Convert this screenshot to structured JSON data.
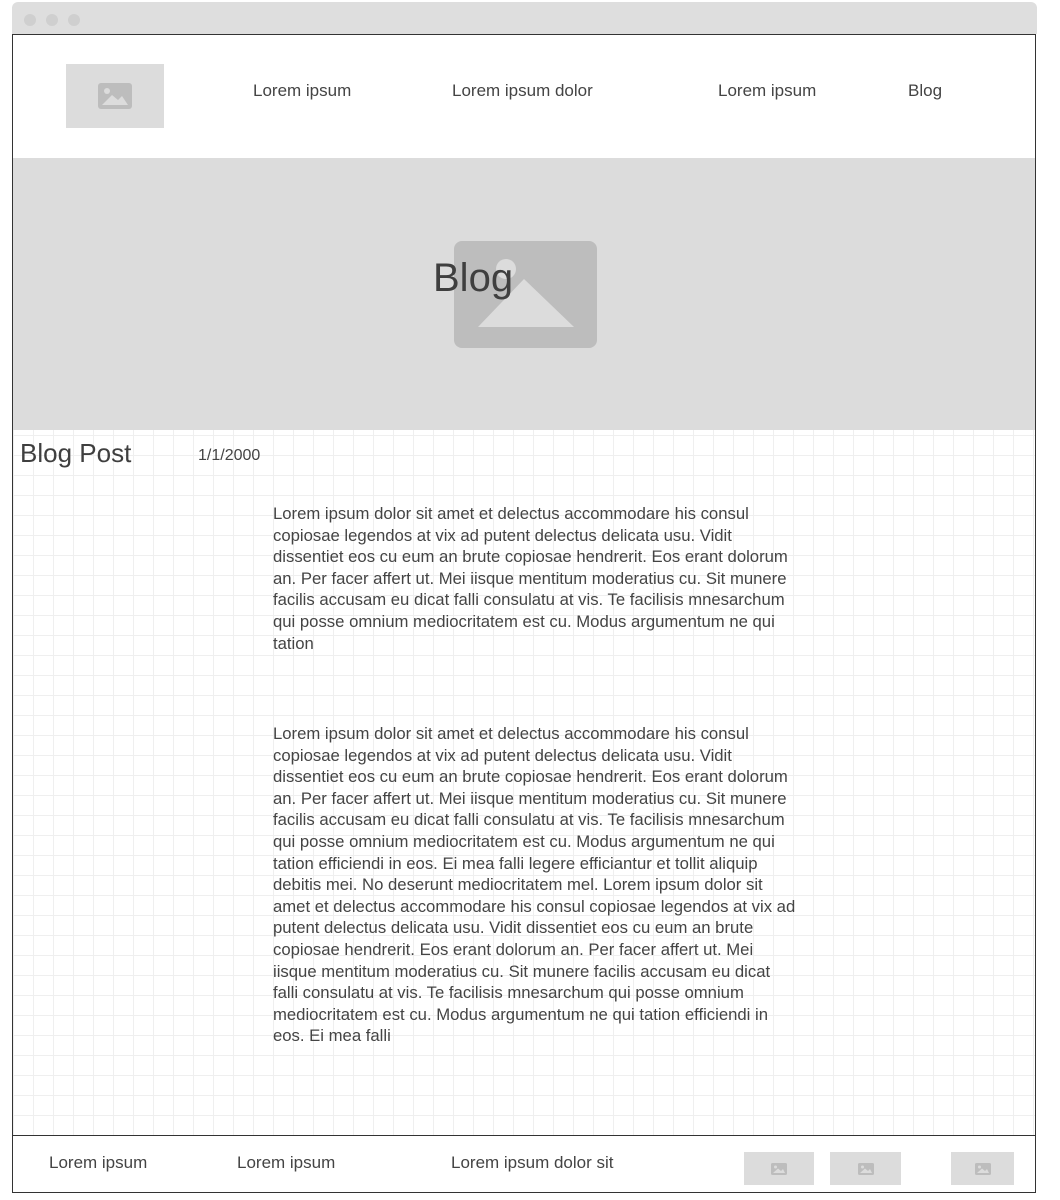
{
  "nav": {
    "links": [
      "Lorem ipsum",
      "Lorem ipsum dolor",
      "Lorem ipsum",
      "Blog"
    ]
  },
  "hero": {
    "title": "Blog"
  },
  "post": {
    "title": "Blog Post",
    "date": "1/1/2000",
    "paragraph1": "Lorem ipsum dolor sit amet et delectus accommodare his consul copiosae legendos at vix ad putent delectus delicata usu. Vidit dissentiet eos cu eum an brute copiosae hendrerit. Eos erant dolorum an. Per facer affert ut. Mei iisque mentitum moderatius cu. Sit munere facilis accusam eu dicat falli consulatu at vis. Te facilisis mnesarchum qui posse omnium mediocritatem est cu. Modus argumentum ne qui tation",
    "paragraph2": "Lorem ipsum dolor sit amet et delectus accommodare his consul copiosae legendos at vix ad putent delectus delicata usu. Vidit dissentiet eos cu eum an brute copiosae hendrerit. Eos erant dolorum an. Per facer affert ut. Mei iisque mentitum moderatius cu. Sit munere facilis accusam eu dicat falli consulatu at vis. Te facilisis mnesarchum qui posse omnium mediocritatem est cu. Modus argumentum ne qui tation efficiendi in eos. Ei mea falli legere efficiantur et tollit aliquip debitis mei. No deserunt mediocritatem mel. Lorem ipsum dolor sit amet et delectus accommodare his consul copiosae legendos at vix ad putent delectus delicata usu. Vidit dissentiet eos cu eum an brute copiosae hendrerit. Eos erant dolorum an. Per facer affert ut. Mei iisque mentitum moderatius cu. Sit munere facilis accusam eu dicat falli consulatu at vis. Te facilisis mnesarchum qui posse omnium mediocritatem est cu. Modus argumentum ne qui tation efficiendi in eos. Ei mea falli"
  },
  "footer": {
    "links": [
      "Lorem ipsum",
      "Lorem ipsum",
      "Lorem ipsum dolor sit"
    ]
  },
  "icons": {
    "logo": "image-placeholder-icon",
    "hero": "image-placeholder-icon",
    "footer": [
      "image-placeholder-icon",
      "image-placeholder-icon",
      "image-placeholder-icon"
    ]
  },
  "colors": {
    "placeholder_bg": "#dcdcdc",
    "placeholder_icon": "#bdbdbd",
    "text": "#444444",
    "border": "#333333"
  }
}
